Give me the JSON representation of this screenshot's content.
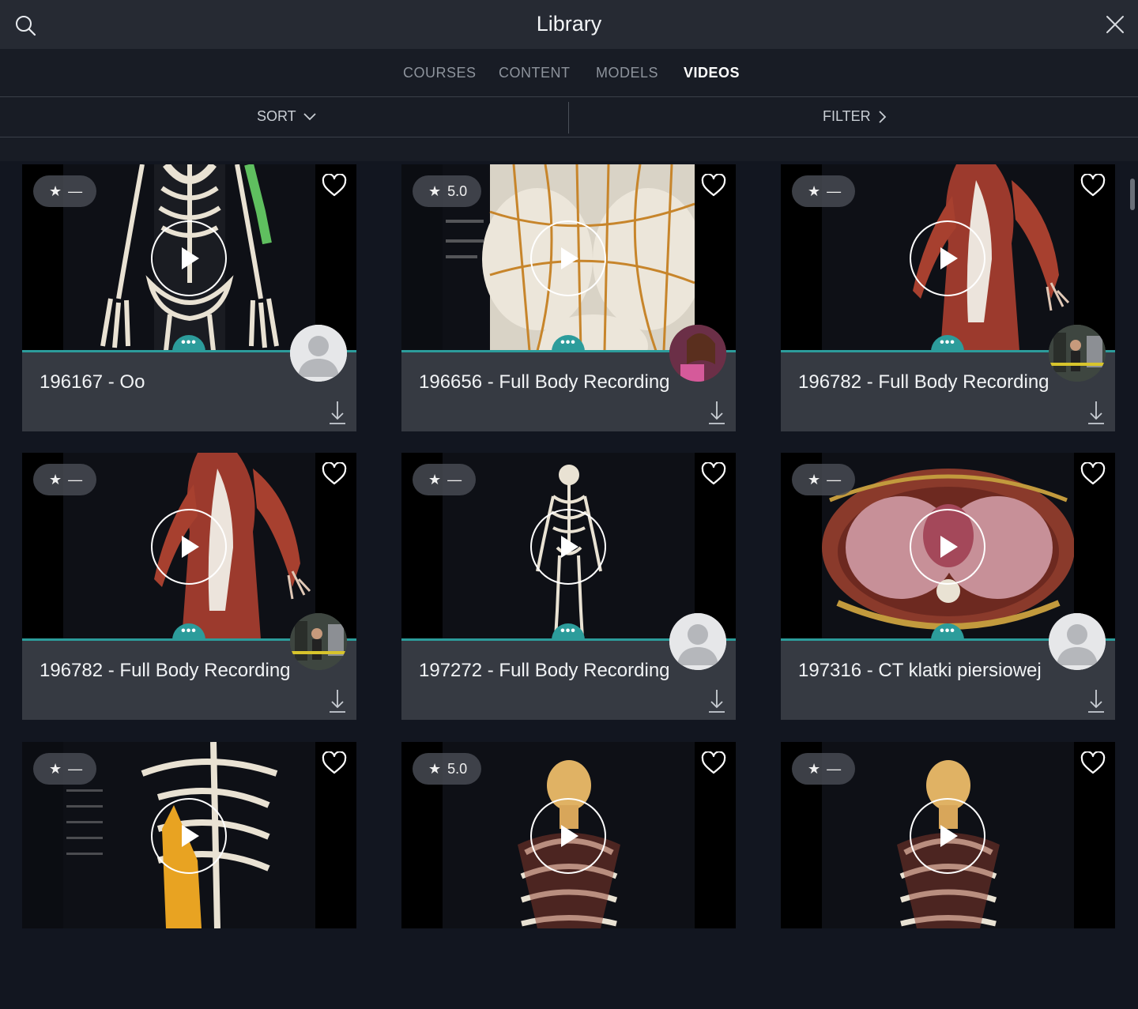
{
  "header": {
    "title": "Library"
  },
  "tabs": [
    {
      "label": "COURSES",
      "active": false
    },
    {
      "label": "CONTENT",
      "active": false
    },
    {
      "label": "MODELS",
      "active": false
    },
    {
      "label": "VIDEOS",
      "active": true
    }
  ],
  "toolbar": {
    "sort_label": "SORT",
    "filter_label": "FILTER"
  },
  "colors": {
    "accent": "#2c9c9b",
    "header_bg": "#262a33",
    "card_info_bg": "#363a42",
    "page_bg": "#121620"
  },
  "videos": [
    {
      "title": "196167 - Oo",
      "rating": "—",
      "thumbnail": "skeleton-hands",
      "avatar": "default-user"
    },
    {
      "title": "196656 - Full Body Recording",
      "rating": "5.0",
      "thumbnail": "pelvis-nerves",
      "avatar": "user-photo"
    },
    {
      "title": "196782 - Full Body Recording",
      "rating": "—",
      "thumbnail": "muscle-figure",
      "avatar": "user-photo"
    },
    {
      "title": "196782 - Full Body Recording",
      "rating": "—",
      "thumbnail": "muscle-figure",
      "avatar": "user-photo"
    },
    {
      "title": "197272 - Full Body Recording",
      "rating": "—",
      "thumbnail": "full-skeleton",
      "avatar": "default-user"
    },
    {
      "title": "197316 - CT klatki piersiowej",
      "rating": "—",
      "thumbnail": "chest-cross-section",
      "avatar": "default-user"
    },
    {
      "title": "",
      "rating": "—",
      "thumbnail": "shoulder-muscle",
      "avatar": ""
    },
    {
      "title": "",
      "rating": "5.0",
      "thumbnail": "skull-torso",
      "avatar": ""
    },
    {
      "title": "",
      "rating": "—",
      "thumbnail": "skull-torso",
      "avatar": ""
    }
  ]
}
